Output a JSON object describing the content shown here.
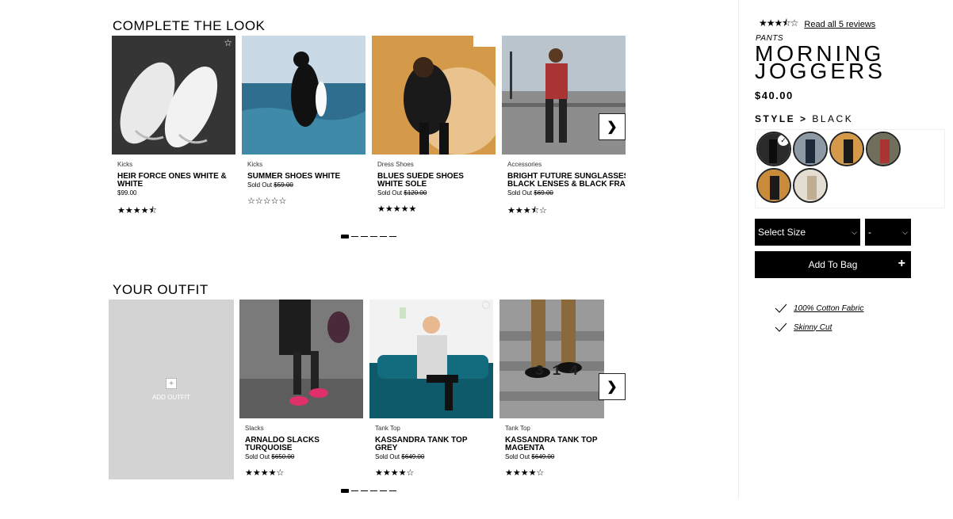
{
  "complete_look": {
    "title": "COMPLETE THE LOOK",
    "items": [
      {
        "category": "Kicks",
        "name": "HEIR FORCE ONES WHITE & WHITE",
        "price_prefix": "",
        "price": "$99.00",
        "stars": "★★★★⯪"
      },
      {
        "category": "Kicks",
        "name": "SUMMER SHOES WHITE",
        "price_prefix": "Sold Out",
        "price": "$59.00",
        "stars": "☆☆☆☆☆"
      },
      {
        "category": "Dress Shoes",
        "name": "BLUES SUEDE SHOES WHITE SOLE",
        "price_prefix": "Sold Out",
        "price": "$120.00",
        "stars": "★★★★★"
      },
      {
        "category": "Accessories",
        "name": "BRIGHT FUTURE SUNGLASSES BLACK LENSES & BLACK FRAME",
        "price_prefix": "Sold Out",
        "price": "$69.00",
        "stars": "★★★⯪☆"
      }
    ]
  },
  "your_outfit": {
    "title": "YOUR OUTFIT",
    "add_label": "ADD OUTFIT",
    "items": [
      {
        "category": "Slacks",
        "name": "ARNALDO SLACKS TURQUOISE",
        "price_prefix": "Sold Out",
        "price": "$650.00",
        "stars": "★★★★☆"
      },
      {
        "category": "Tank Top",
        "name": "KASSANDRA TANK TOP GREY",
        "price_prefix": "Sold Out",
        "price": "$649.00",
        "stars": "★★★★☆"
      },
      {
        "category": "Tank Top",
        "name": "KASSANDRA TANK TOP MAGENTA",
        "price_prefix": "Sold Out",
        "price": "$649.00",
        "stars": "★★★★☆"
      }
    ]
  },
  "product": {
    "rating_stars": "★★★⯪☆",
    "reviews_link": "Read all 5 reviews",
    "category": "PANTS",
    "title": "MORNING JOGGERS",
    "price": "$40.00",
    "style_label": "STYLE >",
    "style_value": "BLACK",
    "size_select": "Select Size",
    "qty_select": "-",
    "add_to_bag": "Add To Bag",
    "features": [
      "100% Cotton Fabric",
      "Skinny Cut"
    ]
  },
  "icons": {
    "next": "chevron-right-icon",
    "plus": "plus-icon",
    "check": "checkmark-icon",
    "favorite": "star-outline-icon"
  }
}
